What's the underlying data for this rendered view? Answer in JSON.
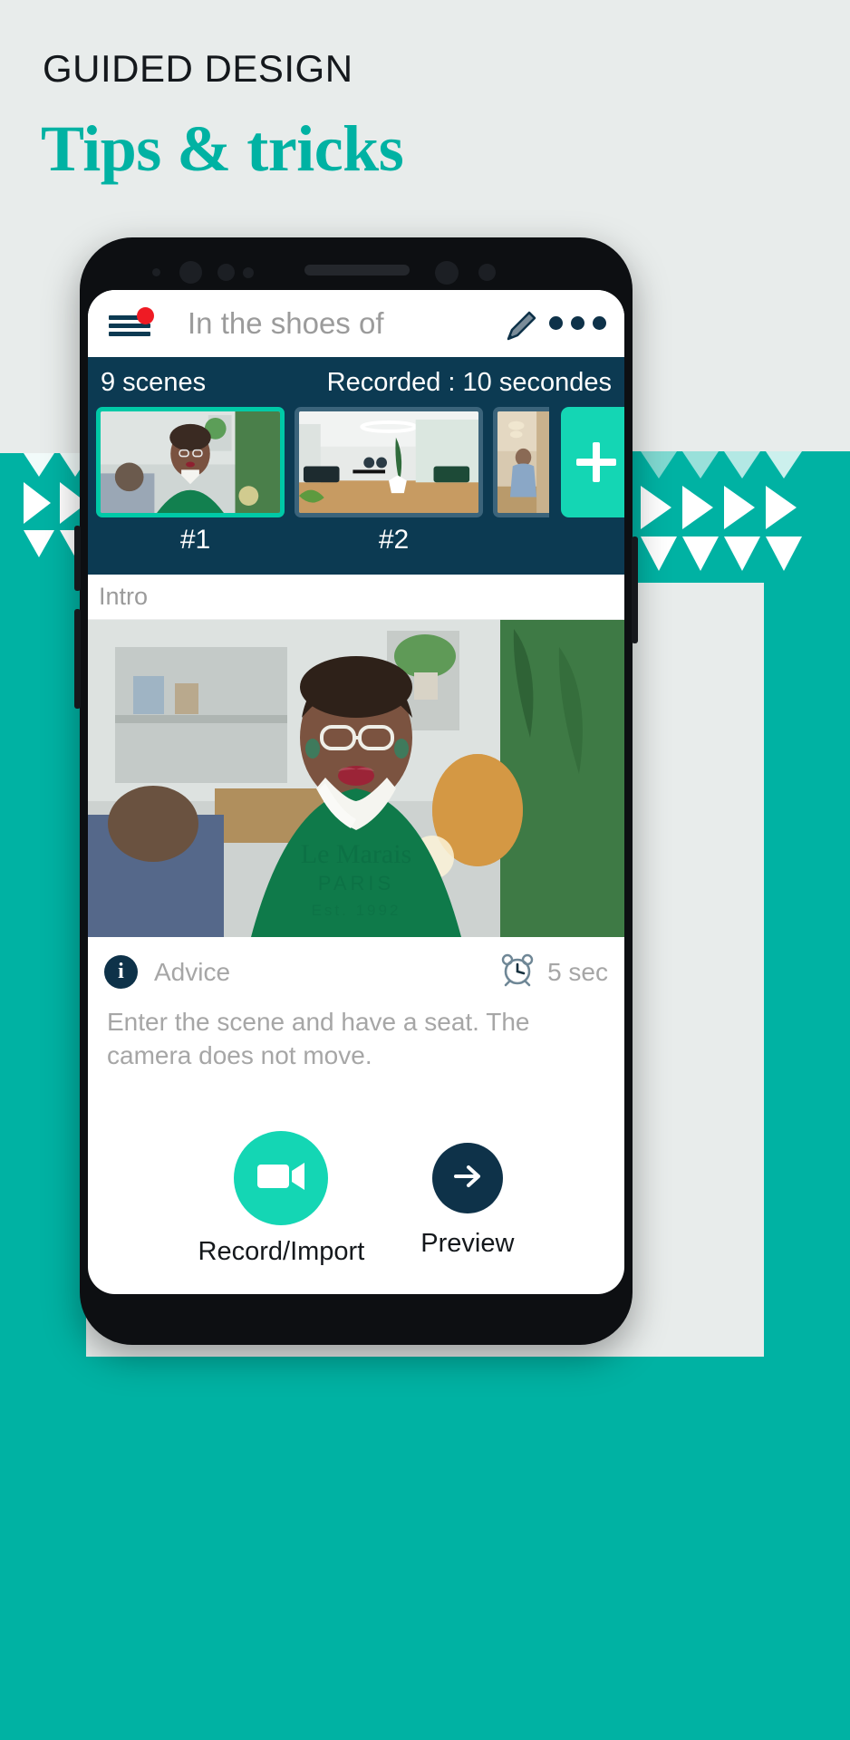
{
  "poster": {
    "kicker": "GUIDED DESIGN",
    "headline": "Tips & tricks",
    "accent_color": "#00b2a3",
    "background_color": "#e8eceb"
  },
  "app": {
    "header": {
      "menu_icon": "hamburger-menu-icon",
      "notification_badge": "",
      "title": "In the shoes of",
      "edit_icon": "pencil-icon",
      "overflow_icon": "three-dots-icon"
    },
    "scenes_bar": {
      "scene_count_label": "9 scenes",
      "recorded_label": "Recorded : 10 secondes",
      "add_scene_label": "+",
      "thumbnails": [
        {
          "label": "#1",
          "selected": true
        },
        {
          "label": "#2",
          "selected": false
        },
        {
          "label": "",
          "selected": false
        }
      ]
    },
    "scene_name": "Intro",
    "advice": {
      "icon": "info-icon",
      "title": "Advice",
      "timer_icon": "alarm-clock-icon",
      "duration": "5 sec",
      "text": "Enter the scene and have a seat. The camera does not move."
    },
    "actions": {
      "record": {
        "label": "Record/Import",
        "icon": "video-camera-icon",
        "color": "#14d6b4"
      },
      "preview": {
        "label": "Preview",
        "icon": "arrow-right-icon",
        "color": "#0e3249"
      }
    }
  }
}
